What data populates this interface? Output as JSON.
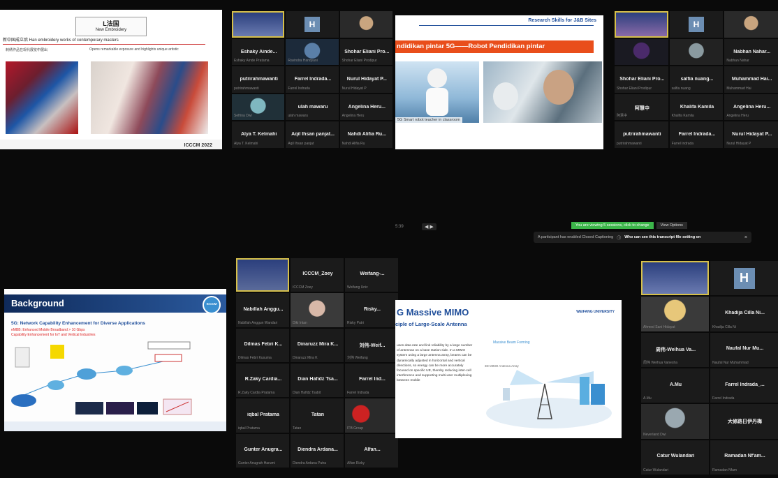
{
  "q1": {
    "slide": {
      "box_title": "L法国",
      "box_subtitle": "New Embroidery",
      "banner": "新中国成立后 Han embroidery works of contemporary masters",
      "col1": "刺绣作品在现代展览中展出",
      "col2": "Opens remarkable exposure and highlights unique artistic",
      "credit": "ICCCM 2022"
    },
    "tiles": [
      {
        "name": "",
        "sub": ""
      },
      {
        "name": "H",
        "sub": ""
      },
      {
        "name": "",
        "sub": ""
      },
      {
        "name": "Eshaky Ainde...",
        "sub": "Eshaky Ainde Pratama"
      },
      {
        "name": "",
        "sub": "Ravindra Handyani"
      },
      {
        "name": "Shohar Eliani Pro...",
        "sub": "Shohar Eliani Prodipur"
      },
      {
        "name": "putrirahmawanti",
        "sub": "putrirahmawanti"
      },
      {
        "name": "Farrel Indrada...",
        "sub": "Farrel Indrada"
      },
      {
        "name": "Nurul Hidayat P...",
        "sub": "Nurul Hidayat P"
      },
      {
        "name": "",
        "sub": "Sefrina Dwi"
      },
      {
        "name": "ulah mawaru",
        "sub": "ulah mawaru"
      },
      {
        "name": "Angelina Heru...",
        "sub": "Angelina Heru"
      },
      {
        "name": "Alya T. Kelmahi",
        "sub": "Alya T. Kelmahi"
      },
      {
        "name": "Aqil Ihsan panjat...",
        "sub": "Aqil Ihsan panjat"
      },
      {
        "name": "Nahdi Alifia Ru...",
        "sub": "Nahdi Alifia Ru"
      }
    ]
  },
  "q2": {
    "slide": {
      "top": "Research Skills for J&B Sites",
      "banner": "ndidikan pintar 5G——Robot Pendidikan pintar",
      "caption": "5G Smart robot teacher in classroom"
    },
    "tiles": [
      {
        "name": "",
        "sub": ""
      },
      {
        "name": "H",
        "sub": ""
      },
      {
        "name": "",
        "sub": ""
      },
      {
        "name": "",
        "sub": ""
      },
      {
        "name": "",
        "sub": ""
      },
      {
        "name": "Nabhan Nahar...",
        "sub": "Nabhan Nahar"
      },
      {
        "name": "Shohar Eliani Pro...",
        "sub": "Shohar Eliani Prodipur"
      },
      {
        "name": "salfia nuang...",
        "sub": "salfia nuang"
      },
      {
        "name": "Muhammad Hai...",
        "sub": "Muhammad Hai"
      },
      {
        "name": "阿慧中",
        "sub": "阿慧中"
      },
      {
        "name": "Khalifa Kamila",
        "sub": "Khalifa Kamila"
      },
      {
        "name": "Angelina Heru...",
        "sub": "Angelina Heru"
      },
      {
        "name": "putrirahmawanti",
        "sub": "putrirahmawanti"
      },
      {
        "name": "Farrel Indrada...",
        "sub": "Farrel Indrada"
      },
      {
        "name": "Nurul Hidayat P...",
        "sub": "Nurul Hidayat P"
      }
    ],
    "notice": "A participant has enabled Closed Captioning",
    "notice_link": "Who can see this transcript file setting on",
    "green_label": "You are viewing 5 sessions, click to change",
    "options_label": "View Options"
  },
  "q3": {
    "slide": {
      "title": "Background",
      "heading": "5G: Network Capability Enhancement for Diverse Applications",
      "red1": "eMBB: Enhanced Mobile Broadband > 10 Gbps",
      "red2": "Capability Enhancement for IoT and Vertical Industries",
      "badge": "ICCCM"
    },
    "tiles": [
      {
        "name": "",
        "sub": ""
      },
      {
        "name": "ICCCM_Zoey",
        "sub": "ICCCM Zoey"
      },
      {
        "name": "Weifang-...",
        "sub": "Weifang Univ"
      },
      {
        "name": "Nabillah Anggu...",
        "sub": "Nabillah Anggun Wandari"
      },
      {
        "name": "",
        "sub": "Diki Intan"
      },
      {
        "name": "Risky...",
        "sub": "Risky Putri"
      },
      {
        "name": "Dilmas Febri K...",
        "sub": "Dilmas Febri Kusuma"
      },
      {
        "name": "Dinaruzz Mira K...",
        "sub": "Dinaruzz Mira K"
      },
      {
        "name": "刘伟-Weif...",
        "sub": "刘伟 Weifang"
      },
      {
        "name": "R.Zaky Cardia...",
        "sub": "R.Zaky Cardia Pratama"
      },
      {
        "name": "Dian Hafidz Tsa...",
        "sub": "Dian Hafidz Tsabit"
      },
      {
        "name": "Farrel Ind...",
        "sub": "Farrel Indrada"
      },
      {
        "name": "iqbal Pratama",
        "sub": "iqbal Pratama"
      },
      {
        "name": "Tatan",
        "sub": "Tatan"
      },
      {
        "name": "",
        "sub": "ITB Group"
      },
      {
        "name": "Gunter Anugra...",
        "sub": "Gunter Anugrah Harumi"
      },
      {
        "name": "Diendra Ardana...",
        "sub": "Diendra Ardana Putra"
      },
      {
        "name": "Alfan...",
        "sub": "Alfan Rizky"
      }
    ]
  },
  "q4": {
    "slide": {
      "title": "G Massive MIMO",
      "subtitle": "ciple of Large-Scale Antenna",
      "body": "uses data rate and link reliability by a large number of antennas on a base station side. In a MIMO system using a large antenna array, beams can be dynamically adjusted in horizontal and vertical directions, so energy can be more accurately focused on specific UE, thereby reducing inter-cell interference and supporting multi-user multiplexing between mobile",
      "fig_label": "Massive Beam Forming",
      "fig_sub": "3D MIMO Antenna Array",
      "logo": "WEIFANG UNIVERSITY"
    },
    "tiles": [
      {
        "name": "",
        "sub": ""
      },
      {
        "name": "H",
        "sub": ""
      },
      {
        "name": "",
        "sub": "Ahmed Sani Hidayat"
      },
      {
        "name": "Khadija Cilla Ni...",
        "sub": "Khadija Cilla Ni"
      },
      {
        "name": "周伟-Weihua Va...",
        "sub": "周伟 Weihua Vanesha"
      },
      {
        "name": "Naufal Nur Mu...",
        "sub": "Naufal Nur Muhammad"
      },
      {
        "name": "A.Mu",
        "sub": "A.Mu"
      },
      {
        "name": "Farrel Indrada_...",
        "sub": "Farrel Indrada"
      },
      {
        "name": "",
        "sub": "Neverland Dwi"
      },
      {
        "name": "大修路日伊丹梅",
        "sub": "大修路日伊丹梅"
      },
      {
        "name": "Catur Wulandari",
        "sub": "Catur Wulandari"
      },
      {
        "name": "Ramadan Nf'am...",
        "sub": "Ramadan Nfam"
      }
    ]
  },
  "center": {
    "playback": "5:39",
    "ctrl": "◀ ▶"
  },
  "colors": {
    "accent_green": "#3cb54a",
    "frame_yellow": "#d6c04a",
    "slide_orange": "#e94e1b",
    "slide_blue": "#1f4e9a"
  }
}
